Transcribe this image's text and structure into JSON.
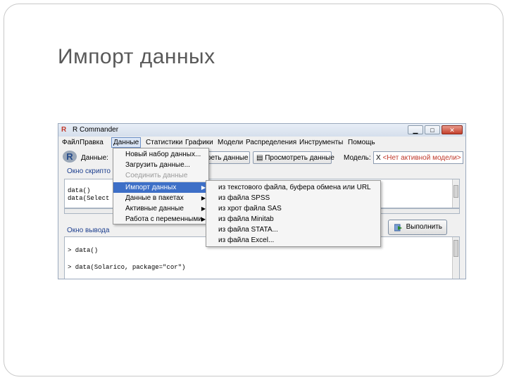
{
  "slide_title": "Импорт данных",
  "window": {
    "title": "R Commander",
    "buttons": {
      "minimize": "▁",
      "maximize": "□",
      "close": "✕"
    }
  },
  "menubar": [
    "Файл",
    "Правка",
    "Данные",
    "Статистики",
    "Графики",
    "Модели",
    "Распределения",
    "Инструменты",
    "Помощь"
  ],
  "toolbar": {
    "data_label": "Данные:",
    "view_label": "отреть данные",
    "browse_label": "Просмотреть данные",
    "model_label": "Модель:",
    "model_value": "<Нет активной модели>"
  },
  "script": {
    "label": "Окно скрипто",
    "lines": [
      "data()",
      "data(Select"
    ]
  },
  "output": {
    "label": "Окно вывода",
    "lines": [
      "> data()",
      "> data(Solarico, package=\"cor\")"
    ]
  },
  "run_button": "Выполнить",
  "data_menu": {
    "items": [
      {
        "label": "Новый набор данных...",
        "submenu": false,
        "disabled": false
      },
      {
        "label": "Загрузить данные...",
        "submenu": false,
        "disabled": false
      },
      {
        "label": "Соединить данные",
        "submenu": false,
        "disabled": true
      },
      {
        "label": "Импорт данных",
        "submenu": true,
        "disabled": false
      },
      {
        "label": "Данные в пакетах",
        "submenu": true,
        "disabled": false
      },
      {
        "label": "Активные данные",
        "submenu": true,
        "disabled": false
      },
      {
        "label": "Работа с переменными",
        "submenu": true,
        "disabled": false
      }
    ]
  },
  "import_menu": {
    "items": [
      "из текстового файла, буфера обмена или URL",
      "из файла SPSS",
      "из хрот файла SAS",
      "из файла Minitab",
      "из файла STATA...",
      "из файла Excel..."
    ]
  },
  "icons": {
    "r_logo": "r-logo-icon",
    "submenu_arrow": "▶",
    "run": "run-icon"
  }
}
